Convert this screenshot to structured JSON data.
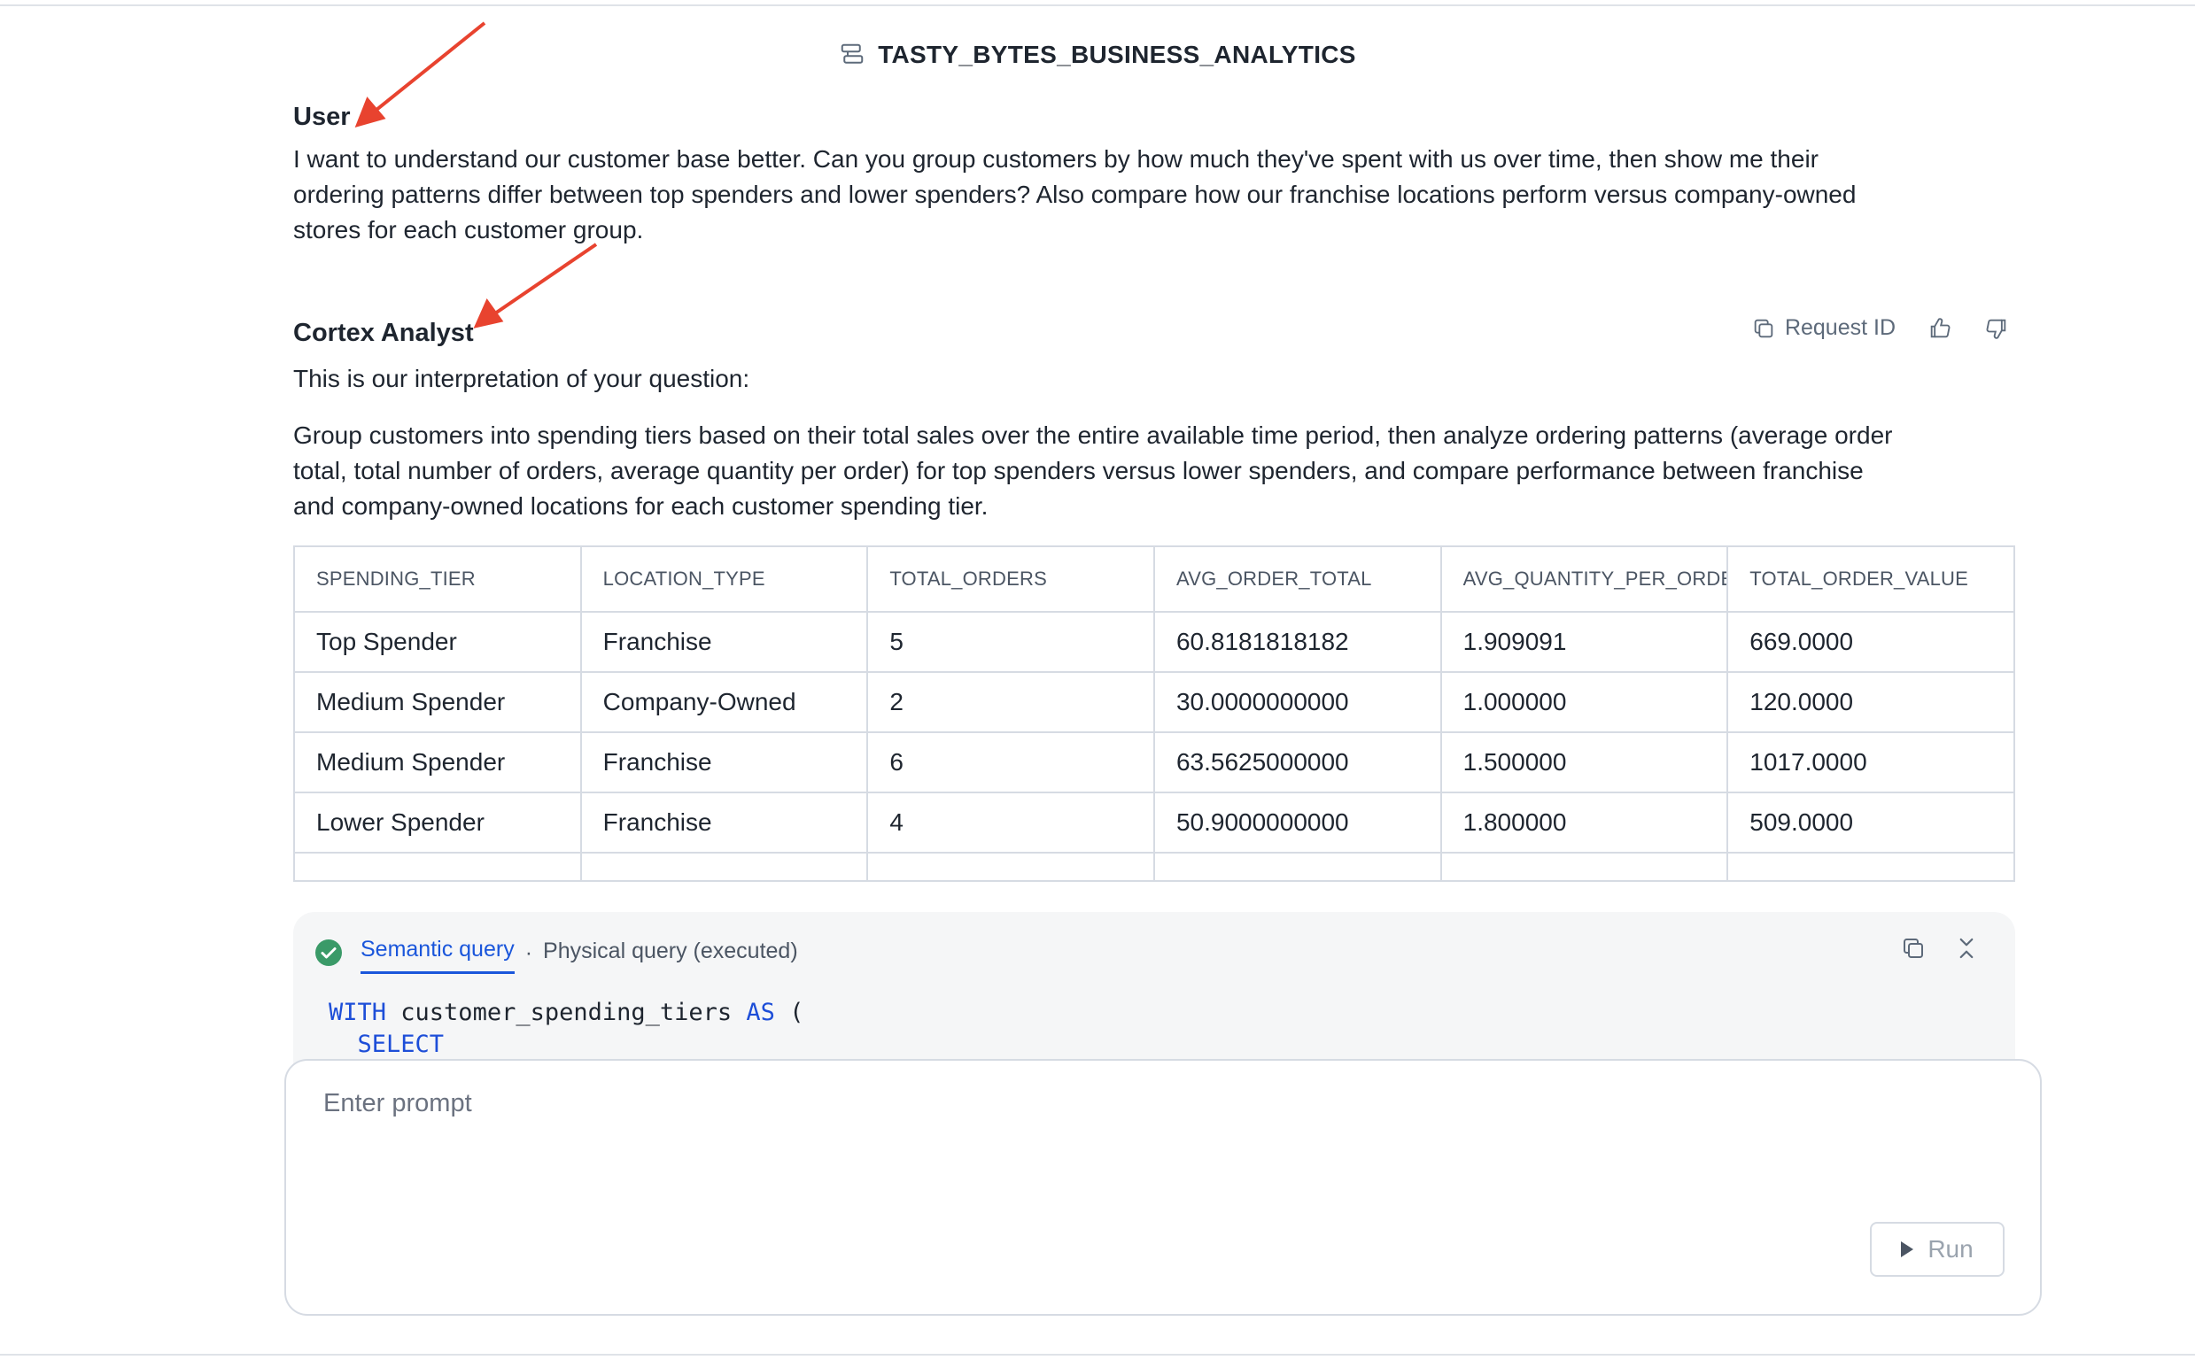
{
  "header": {
    "model_name": "TASTY_BYTES_BUSINESS_ANALYTICS",
    "model_icon": "semantic-model-icon"
  },
  "user_message": {
    "speaker": "User",
    "lines": [
      "I want to understand our customer base better. Can you group customers by how much they've spent with us over time, then show me their",
      "ordering patterns differ between top spenders and lower spenders? Also compare how our franchise locations perform versus company-owned",
      "stores for each customer group."
    ]
  },
  "analyst_message": {
    "speaker": "Cortex Analyst",
    "request_id_label": "Request ID",
    "interpretation_intro": "This is our interpretation of your question:",
    "interpretation_lines": [
      "Group customers into spending tiers based on their total sales over the entire available time period, then analyze ordering patterns (average order",
      "total, total number of orders, average quantity per order) for top spenders versus lower spenders, and compare performance between franchise",
      "and company-owned locations for each customer spending tier."
    ]
  },
  "results_table": {
    "columns": [
      "SPENDING_TIER",
      "LOCATION_TYPE",
      "TOTAL_ORDERS",
      "AVG_ORDER_TOTAL",
      "AVG_QUANTITY_PER_ORDER",
      "TOTAL_ORDER_VALUE"
    ],
    "rows": [
      [
        "Top Spender",
        "Franchise",
        "5",
        "60.8181818182",
        "1.909091",
        "669.0000"
      ],
      [
        "Medium Spender",
        "Company-Owned",
        "2",
        "30.0000000000",
        "1.000000",
        "120.0000"
      ],
      [
        "Medium Spender",
        "Franchise",
        "6",
        "63.5625000000",
        "1.500000",
        "1017.0000"
      ],
      [
        "Lower Spender",
        "Franchise",
        "4",
        "50.9000000000",
        "1.800000",
        "509.0000"
      ]
    ]
  },
  "query_panel": {
    "tab_semantic": "Semantic query",
    "separator": "·",
    "tab_physical": "Physical query (executed)",
    "code": {
      "line1_kw1": "WITH",
      "line1_ident": " customer_spending_tiers ",
      "line1_kw2": "AS",
      "line1_rest": " (",
      "line2_kw": "SELECT"
    }
  },
  "prompt": {
    "placeholder": "Enter prompt",
    "run_label": "Run"
  },
  "colors": {
    "accent": "#1a56db",
    "success": "#3a9a68",
    "annotation_arrow": "#e8432f",
    "border": "#d6dbe3"
  }
}
